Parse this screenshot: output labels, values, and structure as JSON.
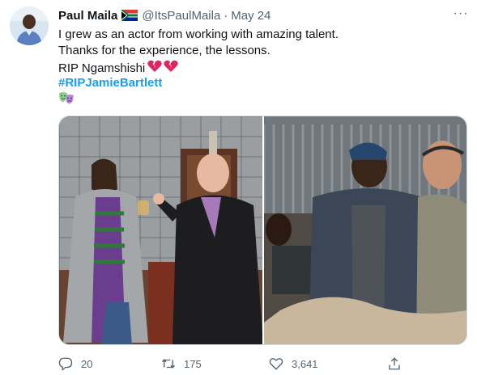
{
  "tweet": {
    "author_name": "Paul Maila",
    "handle": "@ItsPaulMaila",
    "separator": "·",
    "date": "May 24",
    "more_label": "···",
    "lines": [
      "I grew as an actor from working with amazing talent.",
      "Thanks for the experience, the lessons.",
      "RIP Ngamshishi"
    ],
    "hashtag": "#RIPJamieBartlett",
    "icons": {
      "flag": "south-africa-flag-icon",
      "broken_heart": "broken-heart-icon",
      "masks": "theater-masks-icon",
      "more": "more-icon"
    },
    "media_descriptions": []
  },
  "actions": {
    "replies": "20",
    "retweets": "175",
    "likes": "3,641"
  },
  "colors": {
    "link": "#1d9bf0",
    "secondary_text": "#536471",
    "heart_red": "#e0245e",
    "mask_green": "#8fd18c",
    "mask_purple": "#b58bd8"
  }
}
